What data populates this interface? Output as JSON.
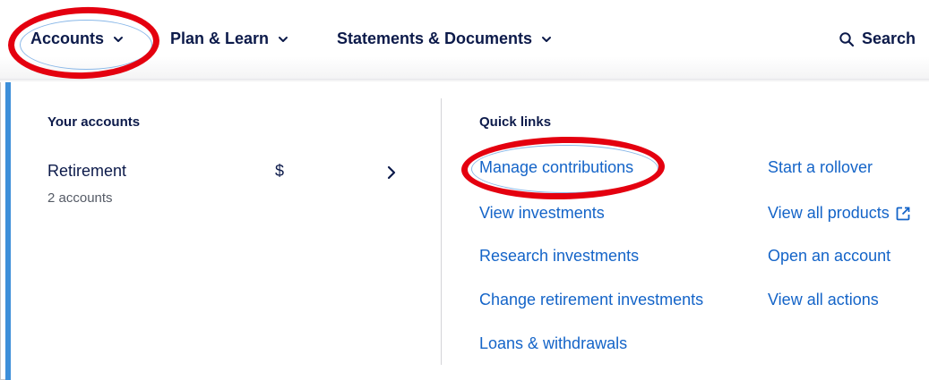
{
  "nav": {
    "accounts_label": "Accounts",
    "plan_label": "Plan & Learn",
    "statements_label": "Statements & Documents",
    "search_label": "Search"
  },
  "your_accounts": {
    "heading": "Your accounts",
    "account": {
      "name": "Retirement",
      "count_text": "2 accounts",
      "balance_symbol": "$"
    }
  },
  "quick_links": {
    "heading": "Quick links",
    "left": [
      "Manage contributions",
      "View investments",
      "Research investments",
      "Change retirement investments",
      "Loans & withdrawals"
    ],
    "right": [
      "Start a rollover",
      "View all products",
      "Open an account",
      "View all actions"
    ]
  },
  "colors": {
    "navy_text": "#0c1a4a",
    "link_blue": "#1464c8",
    "accent_bar": "#3d8fd9",
    "annotation_red": "#e4000f"
  },
  "icons": {
    "nav_chevron": "chevron-down-icon",
    "search": "search-icon",
    "account_arrow": "chevron-right-icon",
    "external_link": "external-link-icon"
  }
}
